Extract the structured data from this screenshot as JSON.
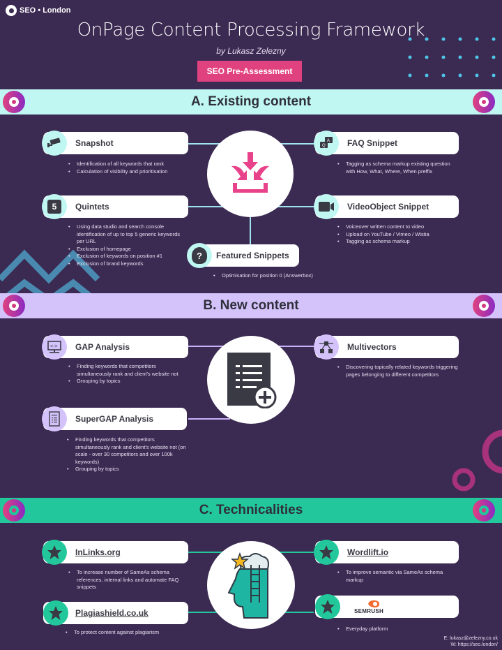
{
  "brand": {
    "logo_text": "SEO • London"
  },
  "header": {
    "title": "OnPage Content Processing Framework",
    "subtitle": "by Lukasz Zelezny",
    "button_label": "SEO Pre-Assessment"
  },
  "colors": {
    "background": "#3b2a52",
    "accent_pink": "#e0427f",
    "section_a": "#c0f7f2",
    "section_b": "#d4c3fb",
    "section_c": "#22c89b"
  },
  "sections": {
    "a": {
      "title": "A. Existing content",
      "hub_icon": "download-arrows-icon",
      "items": [
        {
          "title": "Snapshot",
          "icon": "cctv-camera-icon",
          "bullets": [
            "Identification of all keywords that rank",
            "Calculation of visibility and prioritisation"
          ]
        },
        {
          "title": "Quintets",
          "icon": "number-5-icon",
          "bullets": [
            "Using data studio and search console identification of up to top 5 generic keywords per URL",
            "Exclusion of homepage",
            "Exclusion of keywords on position #1",
            "Exclusion of brand keywords"
          ]
        },
        {
          "title": "FAQ Snippet",
          "icon": "qa-chat-icon",
          "bullets": [
            "Tagging as schema markup existing question with How, What, Where, When preffix"
          ]
        },
        {
          "title": "VideoObject Snippet",
          "icon": "video-camera-icon",
          "bullets": [
            "Voiceover written content to video",
            "Upload on YouTube / Vimeo / Wistia",
            "Tagging as schema markup"
          ]
        },
        {
          "title": "Featured Snippets",
          "icon": "question-head-icon",
          "bullets": [
            "Optimisation for position 0 (Answerbox)"
          ]
        }
      ]
    },
    "b": {
      "title": "B. New content",
      "hub_icon": "document-add-icon",
      "items": [
        {
          "title": "GAP Analysis",
          "icon": "monitor-compare-icon",
          "bullets": [
            "Finding keywords that competitors simultaneously rank and client's website not",
            "Grouping by topics"
          ]
        },
        {
          "title": "SuperGAP Analysis",
          "icon": "document-list-icon",
          "bullets": [
            "Finding keywords that competitors simultaneously rank and client's website not (on scale - over 30 competitors and over 100k keywords)",
            "Grouping by topics"
          ]
        },
        {
          "title": "Multivectors",
          "icon": "vector-nodes-icon",
          "bullets": [
            "Discovering topically related keywords triggering pages belonging to different competitors"
          ]
        }
      ]
    },
    "c": {
      "title": "C. Technicalities",
      "hub_icon": "head-ladder-star-icon",
      "items": [
        {
          "title": "InLinks.org",
          "icon": "star-icon",
          "bullets": [
            "To increase number of SameAs schema references, internal links and automate FAQ snippets"
          ]
        },
        {
          "title": "Plagiashield.co.uk",
          "icon": "star-icon",
          "bullets": [
            "To protect content against plagiarism"
          ]
        },
        {
          "title": "Wordlift.io",
          "icon": "star-icon",
          "bullets": [
            "To improve semantic via SameAs schema markup"
          ]
        },
        {
          "title": "SEMRUSH",
          "icon": "star-icon",
          "bullets": [
            "Everyday platform"
          ]
        }
      ]
    }
  },
  "footer": {
    "email": "E: lukasz@zelezny.co.uk",
    "web_label": "W: ",
    "web_link": "https://seo.london/"
  }
}
